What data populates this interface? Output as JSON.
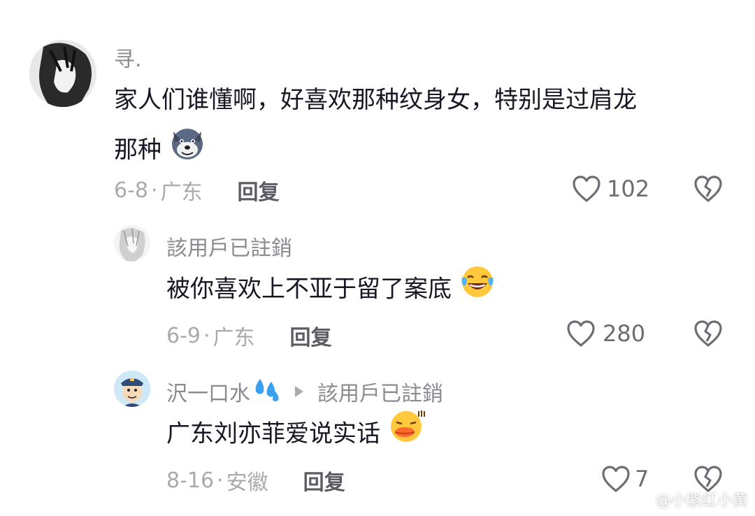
{
  "comments": [
    {
      "username": "寻.",
      "text_line1": "家人们谁懂啊，好喜欢那种纹身女，特别是过肩龙",
      "text_line2": "那种",
      "emoji": "wolf-emoji",
      "date": "6-8",
      "location": "广东",
      "reply_label": "回复",
      "likes": "102"
    },
    {
      "username": "該用戶已註銷",
      "text": "被你喜欢上不亚于留了案底",
      "emoji": "laugh-tears-emoji",
      "date": "6-9",
      "location": "广东",
      "reply_label": "回复",
      "likes": "280"
    },
    {
      "username": "沢一口水",
      "username_emoji": "sweat-droplets-emoji",
      "reply_to": "該用戶已註銷",
      "text": "广东刘亦菲爱说实话",
      "emoji": "duck-lips-emoji",
      "date": "8-16",
      "location": "安徽",
      "reply_label": "回复",
      "likes": "7"
    }
  ],
  "separator": "·",
  "watermark": "@小紫红小黄",
  "colors": {
    "text": "#161823",
    "meta": "#a9aaae",
    "username": "#8a8b91"
  }
}
